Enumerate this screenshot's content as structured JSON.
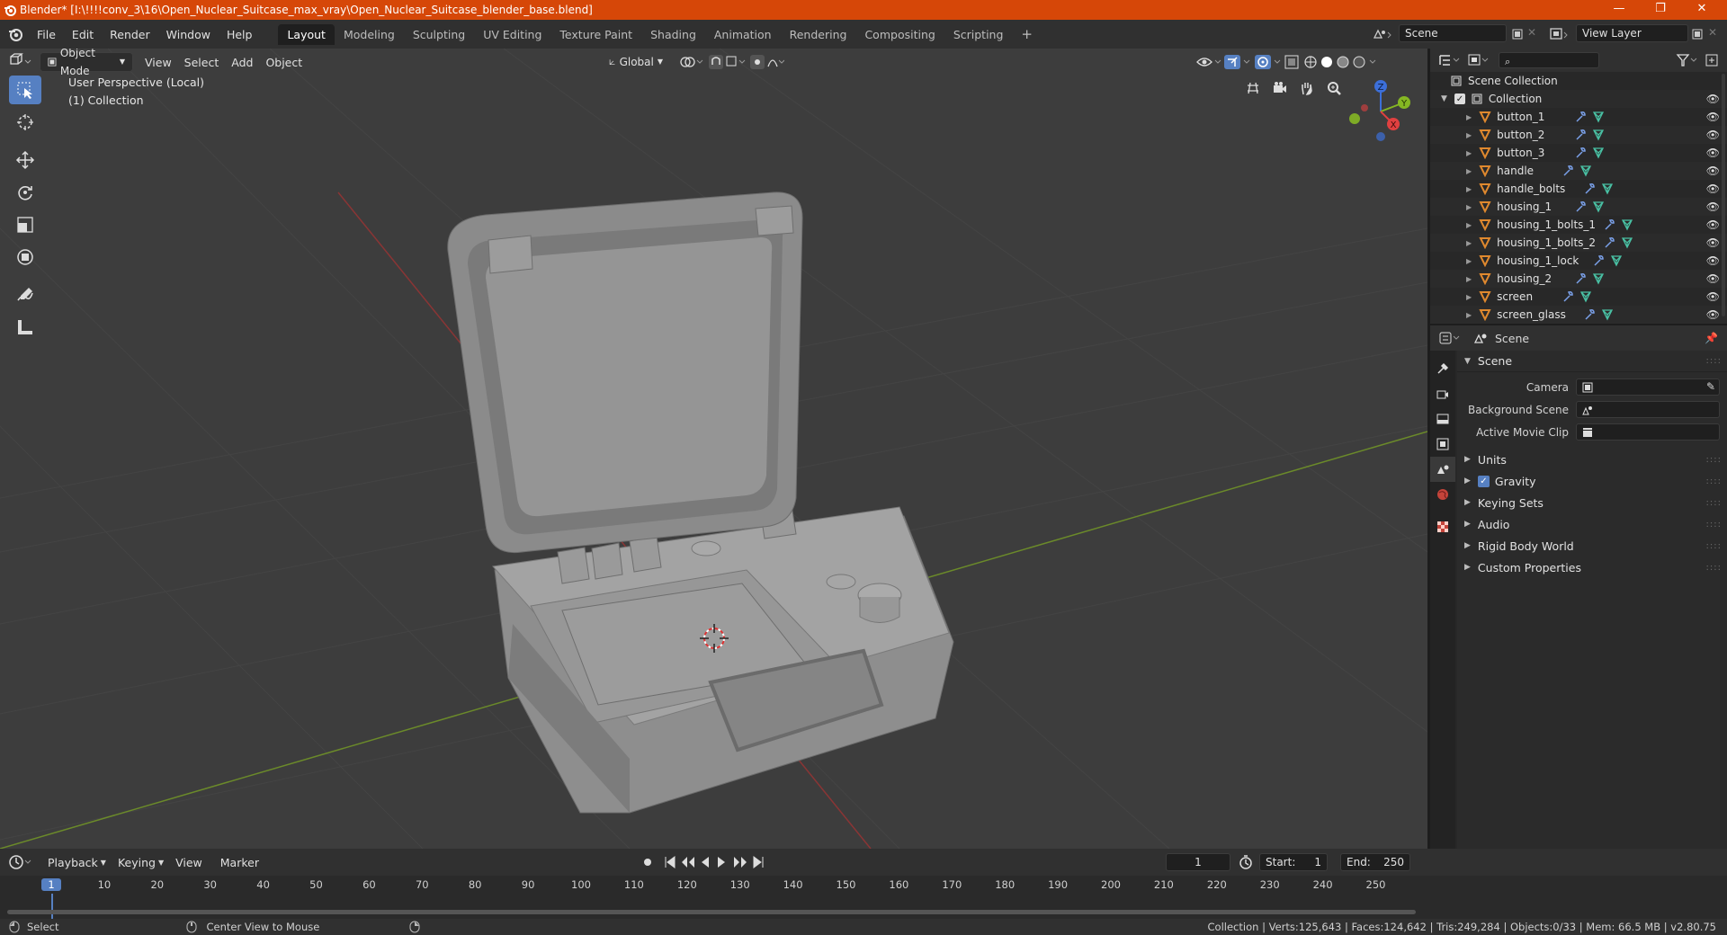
{
  "window": {
    "title": "Blender* [I:\\!!!!conv_3\\16\\Open_Nuclear_Suitcase_max_vray\\Open_Nuclear_Suitcase_blender_base.blend]",
    "minimize": "—",
    "maximize": "❐",
    "close": "✕"
  },
  "topbar": {
    "menu": [
      "File",
      "Edit",
      "Render",
      "Window",
      "Help"
    ],
    "workspaces": [
      "Layout",
      "Modeling",
      "Sculpting",
      "UV Editing",
      "Texture Paint",
      "Shading",
      "Animation",
      "Rendering",
      "Compositing",
      "Scripting"
    ],
    "active_workspace": "Layout",
    "add_tab": "+",
    "scene": "Scene",
    "view_layer": "View Layer"
  },
  "viewport": {
    "mode": "Object Mode",
    "menu": [
      "View",
      "Select",
      "Add",
      "Object"
    ],
    "orientation": "Global",
    "perspective_label": "User Perspective (Local)",
    "collection_label": "(1) Collection",
    "gizmo": {
      "x": "X",
      "y": "Y",
      "z": "Z"
    }
  },
  "outliner": {
    "root": "Scene Collection",
    "collection": "Collection",
    "objects": [
      "button_1",
      "button_2",
      "button_3",
      "handle",
      "handle_bolts",
      "housing_1",
      "housing_1_bolts_1",
      "housing_1_bolts_2",
      "housing_1_lock",
      "housing_2",
      "screen",
      "screen_glass"
    ]
  },
  "properties": {
    "context": "Scene",
    "panel": "Scene",
    "rows": [
      {
        "label": "Camera"
      },
      {
        "label": "Background Scene"
      },
      {
        "label": "Active Movie Clip"
      }
    ],
    "subpanels": [
      "Units",
      "Gravity",
      "Keying Sets",
      "Audio",
      "Rigid Body World",
      "Custom Properties"
    ],
    "gravity_checked": true
  },
  "timeline": {
    "menu": [
      "Playback",
      "Keying",
      "View",
      "Marker"
    ],
    "current_frame": "1",
    "start_label": "Start:",
    "start": "1",
    "end_label": "End:",
    "end": "250",
    "ticks": [
      "1",
      "10",
      "20",
      "30",
      "40",
      "50",
      "60",
      "70",
      "80",
      "90",
      "100",
      "110",
      "120",
      "130",
      "140",
      "150",
      "160",
      "170",
      "180",
      "190",
      "200",
      "210",
      "220",
      "230",
      "240",
      "250"
    ]
  },
  "statusbar": {
    "left": "Select",
    "middle": "Center View to Mouse",
    "stats": "Collection | Verts:125,643 | Faces:124,642 | Tris:249,284 | Objects:0/33 | Mem: 66.5 MB | v2.80.75"
  },
  "colors": {
    "accent": "#5680c2",
    "titlebar": "#d64708",
    "object_icon": "#e0892e",
    "mesh_icon": "#49c1a4"
  }
}
